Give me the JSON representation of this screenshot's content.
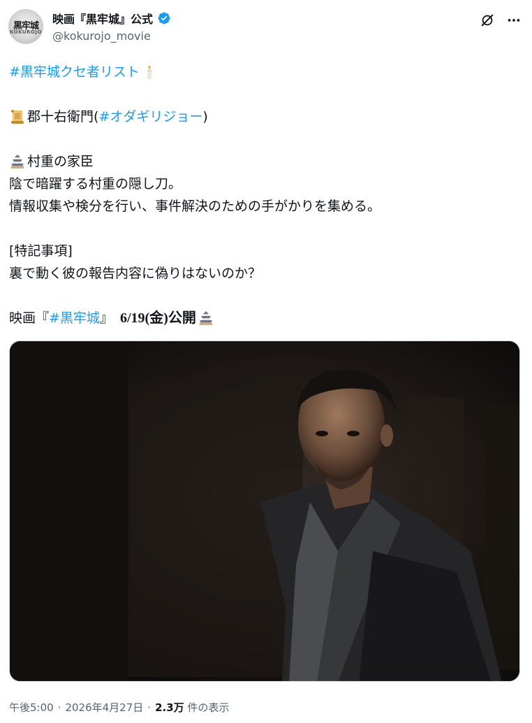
{
  "header": {
    "avatar_kanji": "黒牢城",
    "avatar_roman": "KOKUROJO",
    "display_name": "映画『黒牢城』公式",
    "handle": "@kokurojo_movie"
  },
  "body": {
    "hashtag_list": "#黒牢城クセ者リスト",
    "character_name": "郡十右衛門(",
    "actor_hashtag": "#オダギリジョー",
    "character_close": ")",
    "role": "村重の家臣",
    "desc_line1": "陰で暗躍する村重の隠し刀。",
    "desc_line2": "情報収集や検分を行い、事件解決のための手がかりを集める。",
    "notes_heading": "[特記事項]",
    "notes_line": "裏で動く彼の報告内容に偽りはないのか？",
    "release_prefix": "映画『",
    "release_hashtag": "#黒牢城",
    "release_suffix": "』",
    "release_date": "6/19(金)公開"
  },
  "media": {
    "icon_names": [
      "candle-icon",
      "scroll-icon",
      "castle-icon"
    ]
  },
  "meta": {
    "time": "午後5:00",
    "sep1": "·",
    "date": "2026年4月27日",
    "sep2": "·",
    "views_count": "2.3万",
    "views_label": "件の表示"
  },
  "colors": {
    "link": "#1d9bf0",
    "text": "#0f1419",
    "muted": "#536471",
    "verified": "#1d9bf0"
  }
}
